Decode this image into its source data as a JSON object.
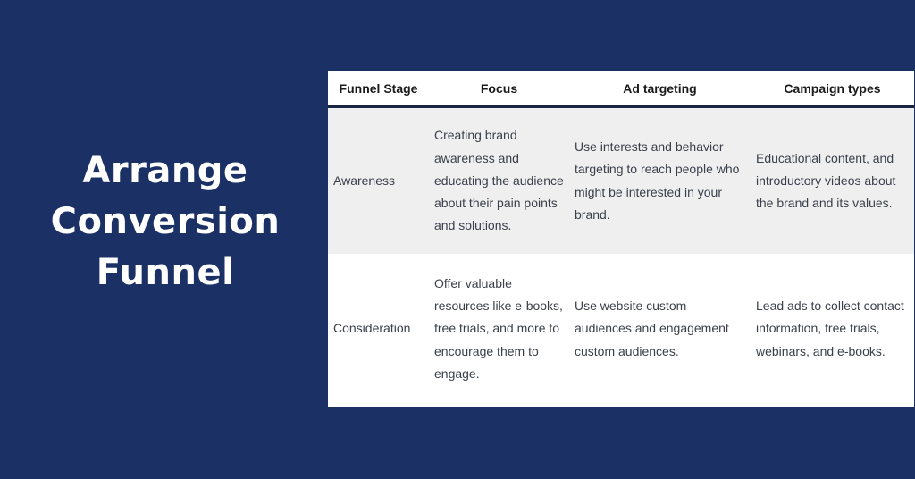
{
  "title": {
    "lines": [
      "Arrange",
      "Conversion",
      "Funnel"
    ]
  },
  "table": {
    "headers": [
      "Funnel Stage",
      "Focus",
      "Ad targeting",
      "Campaign types"
    ],
    "rows": [
      {
        "stage": "Awareness",
        "focus": "Creating brand awareness and educating the audience about their pain points and solutions.",
        "ad_targeting": "Use interests and behavior targeting to reach people who might be interested in your brand.",
        "campaign_types": "Educational content, and introductory videos about the brand and its values."
      },
      {
        "stage": "Consideration",
        "focus": "Offer valuable resources like e-books, free trials, and more to encourage them to engage.",
        "ad_targeting": "Use website custom audiences and engagement custom audiences.",
        "campaign_types": "Lead ads to collect contact information, free trials, webinars, and e-books."
      }
    ]
  },
  "colors": {
    "background": "#1b3166",
    "row_shaded": "#efefef",
    "header_rule": "#1b2342"
  }
}
